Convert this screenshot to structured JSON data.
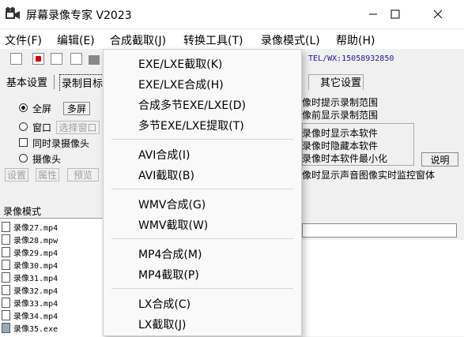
{
  "window": {
    "title": "屏幕录像专家 V2023",
    "controls": {
      "minimize": "—",
      "maximize": "☐",
      "close": "✕"
    }
  },
  "menubar": [
    "文件(F)",
    "编辑(E)",
    "合成截取(J)",
    "转换工具(T)",
    "录像模式(L)",
    "帮助(H)"
  ],
  "toolbar": {
    "contact": "TEL/WX:15058932850"
  },
  "tabs": {
    "basic": "基本设置",
    "record_target": "录制目标",
    "other": "其它设置"
  },
  "record_target": {
    "fullscreen": "全屏",
    "multiscreen": "多屏",
    "window": "窗口",
    "select_window": "选择窗口",
    "record_camera_too": "同时录摄像头",
    "camera": "摄像头",
    "setup": "设置",
    "properties": "属性",
    "preview": "预览"
  },
  "right_panel": {
    "line1": "像时提示录制范围",
    "line2": "像前显示录制范围",
    "opt1": "录像时显示本软件",
    "opt2": "录像时隐藏本软件",
    "opt3": "录像时本软件最小化",
    "explain": "说明",
    "line3": "像时显示声音图像实时监控窗体"
  },
  "list": {
    "header": "录像模式",
    "files": [
      "录像27.mp4",
      "录像28.mpw",
      "录像29.mp4",
      "录像30.mp4",
      "录像31.mp4",
      "录像32.mp4",
      "录像33.mp4",
      "录像34.mp4",
      "录像35.exe"
    ]
  },
  "dropdown": {
    "groups": [
      [
        "EXE/LXE截取(K)",
        "EXE/LXE合成(H)",
        "合成多节EXE/LXE(D)",
        "多节EXE/LXE提取(T)"
      ],
      [
        "AVI合成(I)",
        "AVI截取(B)"
      ],
      [
        "WMV合成(G)",
        "WMV截取(W)"
      ],
      [
        "MP4合成(M)",
        "MP4截取(P)"
      ],
      [
        "LX合成(C)",
        "LX截取(J)"
      ]
    ]
  }
}
